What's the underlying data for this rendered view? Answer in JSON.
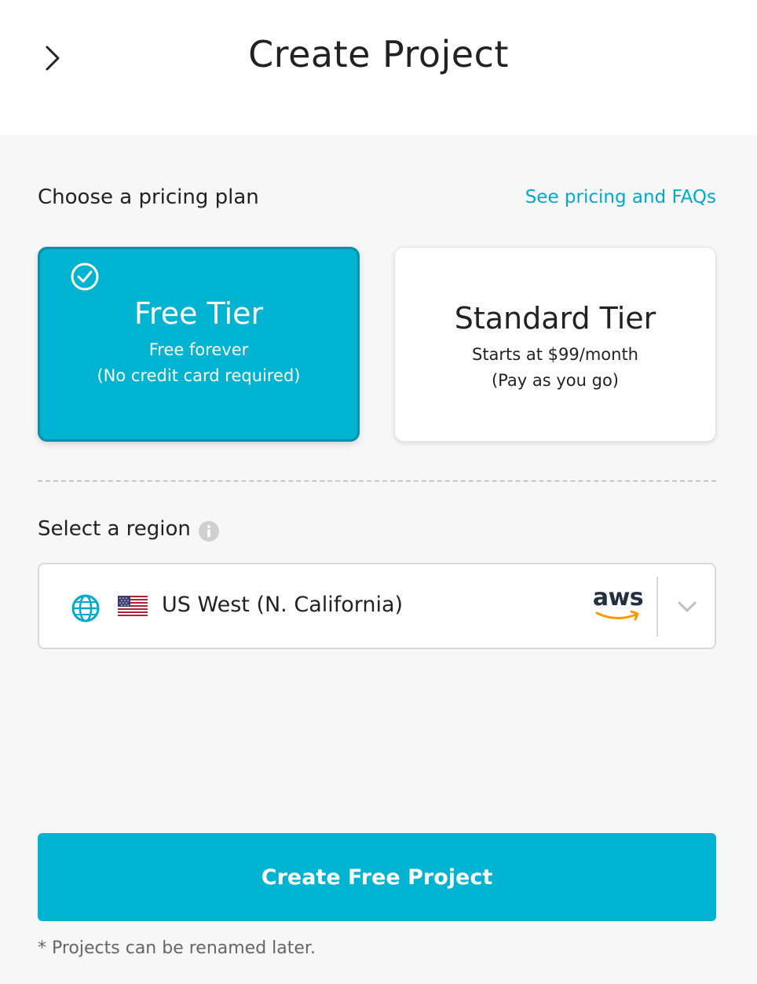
{
  "header": {
    "title": "Create Project",
    "back_icon": "chevron-right-icon"
  },
  "pricing": {
    "label": "Choose a pricing plan",
    "link": "See pricing and FAQs",
    "tiers": [
      {
        "name": "Free Tier",
        "line1": "Free forever",
        "line2": "(No credit card required)",
        "selected": true
      },
      {
        "name": "Standard Tier",
        "line1": "Starts at $99/month",
        "line2": "(Pay as you go)",
        "selected": false
      }
    ]
  },
  "region": {
    "label": "Select a region",
    "value": "US West (N. California)",
    "provider": "aws"
  },
  "cta": {
    "label": "Create Free Project"
  },
  "footnote": "* Projects can be renamed later.",
  "colors": {
    "accent": "#00b3d1",
    "accent_border": "#0b8ea6",
    "link": "#00aacc",
    "aws_orange": "#ff9900"
  }
}
